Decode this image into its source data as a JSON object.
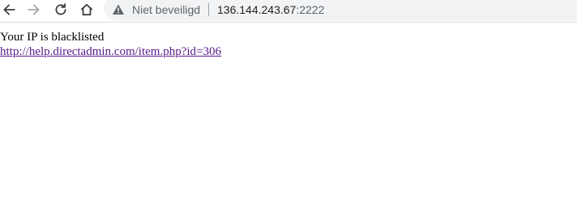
{
  "browser": {
    "security_label": "Niet beveiligd",
    "url_host": "136.144.243.67",
    "url_port": ":2222",
    "icons": {
      "back": "arrow-left-icon",
      "forward": "arrow-right-icon",
      "reload": "reload-icon",
      "home": "home-icon",
      "security": "warning-triangle-icon"
    },
    "colors": {
      "omnibox_bg": "#f1f3f4",
      "icon": "#5f6368",
      "icon_disabled": "#c4c7c5",
      "link_visited": "#551a8b"
    }
  },
  "page": {
    "message": "Your IP is blacklisted",
    "link_text": "http://help.directadmin.com/item.php?id=306"
  }
}
